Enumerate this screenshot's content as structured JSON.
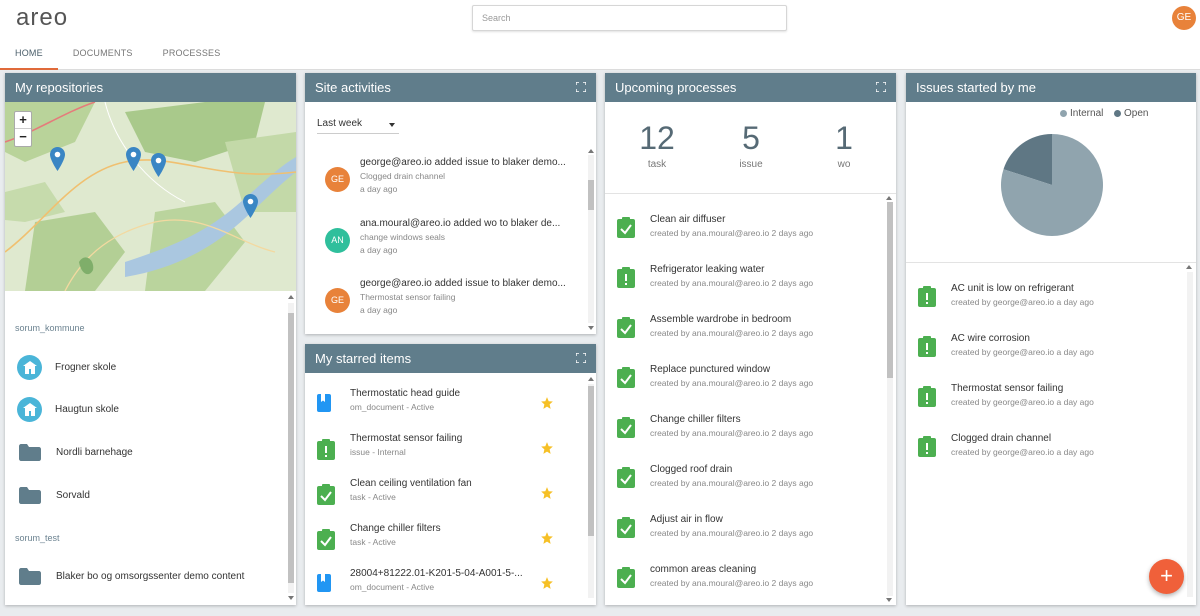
{
  "app": {
    "logo": "areo",
    "user_initials": "GE"
  },
  "search": {
    "placeholder": "Search"
  },
  "nav": {
    "tabs": [
      "HOME",
      "DOCUMENTS",
      "PROCESSES"
    ]
  },
  "repositories": {
    "title": "My repositories",
    "map": {
      "zoom_in": "+",
      "zoom_out": "−"
    },
    "groups": [
      {
        "name": "sorum_kommune",
        "items": [
          {
            "label": "Frogner skole",
            "icon": "school-icon"
          },
          {
            "label": "Haugtun skole",
            "icon": "school-icon"
          },
          {
            "label": "Nordli barnehage",
            "icon": "folder-icon"
          },
          {
            "label": "Sorvald",
            "icon": "folder-icon"
          }
        ]
      },
      {
        "name": "sorum_test",
        "items": [
          {
            "label": "Blaker bo og omsorgssenter demo content",
            "icon": "folder-icon"
          }
        ]
      }
    ]
  },
  "site_activities": {
    "title": "Site activities",
    "filter": "Last week",
    "items": [
      {
        "initials": "GE",
        "color": "#e8823a",
        "title": "george@areo.io added issue to blaker demo...",
        "subtitle": "Clogged drain channel",
        "time": "a day ago"
      },
      {
        "initials": "AN",
        "color": "#2fbf9c",
        "title": "ana.moural@areo.io added wo to blaker de...",
        "subtitle": "change windows seals",
        "time": "a day ago"
      },
      {
        "initials": "GE",
        "color": "#e8823a",
        "title": "george@areo.io added issue to blaker demo...",
        "subtitle": "Thermostat sensor failing",
        "time": "a day ago"
      }
    ]
  },
  "starred": {
    "title": "My starred items",
    "items": [
      {
        "icon": "document-icon",
        "title": "Thermostatic head guide",
        "subtitle": "om_document - Active"
      },
      {
        "icon": "issue-icon",
        "title": "Thermostat sensor failing",
        "subtitle": "issue - Internal"
      },
      {
        "icon": "task-icon",
        "title": "Clean ceiling ventilation fan",
        "subtitle": "task - Active"
      },
      {
        "icon": "task-icon",
        "title": "Change chiller filters",
        "subtitle": "task - Active"
      },
      {
        "icon": "document-icon",
        "title": "28004+81222.01-K201-5-04-A001-5-...",
        "subtitle": "om_document - Active"
      }
    ]
  },
  "upcoming": {
    "title": "Upcoming processes",
    "stats": [
      {
        "value": "12",
        "label": "task"
      },
      {
        "value": "5",
        "label": "issue"
      },
      {
        "value": "1",
        "label": "wo"
      }
    ],
    "items": [
      {
        "icon": "task-icon",
        "title": "Clean air diffuser",
        "subtitle": "created by ana.moural@areo.io 2 days ago"
      },
      {
        "icon": "issue-icon",
        "title": "Refrigerator leaking water",
        "subtitle": "created by ana.moural@areo.io 2 days ago"
      },
      {
        "icon": "task-icon",
        "title": "Assemble wardrobe in bedroom",
        "subtitle": "created by ana.moural@areo.io 2 days ago"
      },
      {
        "icon": "task-icon",
        "title": "Replace punctured window",
        "subtitle": "created by ana.moural@areo.io 2 days ago"
      },
      {
        "icon": "task-icon",
        "title": "Change chiller filters",
        "subtitle": "created by ana.moural@areo.io 2 days ago"
      },
      {
        "icon": "task-icon",
        "title": "Clogged roof drain",
        "subtitle": "created by ana.moural@areo.io 2 days ago"
      },
      {
        "icon": "task-icon",
        "title": "Adjust air in flow",
        "subtitle": "created by ana.moural@areo.io 2 days ago"
      },
      {
        "icon": "task-icon",
        "title": "common areas cleaning",
        "subtitle": "created by ana.moural@areo.io 2 days ago"
      }
    ]
  },
  "issues": {
    "title": "Issues started by me",
    "legend": [
      {
        "label": "Internal",
        "color": "#90a4ae"
      },
      {
        "label": "Open",
        "color": "#5f7784"
      }
    ],
    "items": [
      {
        "title": "AC unit is low on refrigerant",
        "subtitle": "created by george@areo.io a day ago"
      },
      {
        "title": "AC wire corrosion",
        "subtitle": "created by george@areo.io a day ago"
      },
      {
        "title": "Thermostat sensor failing",
        "subtitle": "created by george@areo.io a day ago"
      },
      {
        "title": "Clogged drain channel",
        "subtitle": "created by george@areo.io a day ago"
      }
    ]
  },
  "chart_data": {
    "type": "pie",
    "categories": [
      "Internal",
      "Open"
    ],
    "values": [
      80,
      20
    ]
  },
  "fab": {
    "label": "+"
  }
}
